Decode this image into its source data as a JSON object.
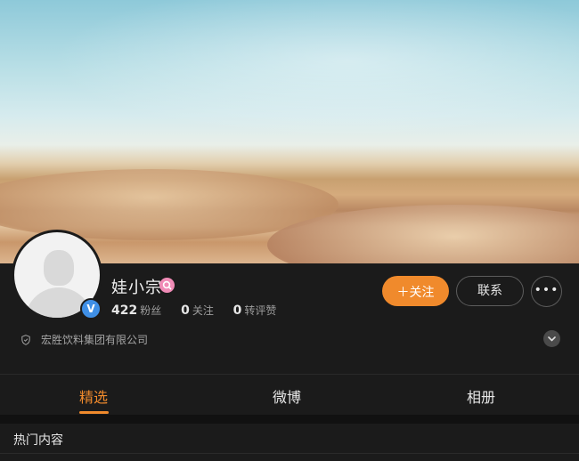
{
  "profile": {
    "name": "娃小宗",
    "verified_badge": "V",
    "level_icon": "search-icon"
  },
  "stats": {
    "fans_count": "422",
    "fans_label": "粉丝",
    "following_count": "0",
    "following_label": "关注",
    "likes_count": "0",
    "likes_label": "转评赞"
  },
  "actions": {
    "follow_label": "＋关注",
    "contact_label": "联系",
    "more_label": "•••"
  },
  "company": {
    "name": "宏胜饮料集团有限公司"
  },
  "tabs": [
    {
      "label": "精选"
    },
    {
      "label": "微博"
    },
    {
      "label": "相册"
    }
  ],
  "section": {
    "title": "热门内容"
  },
  "colors": {
    "accent": "#f08a2c",
    "background": "#1b1b1b",
    "verified": "#3f8fe6",
    "level_badge": "#f08bb6"
  }
}
